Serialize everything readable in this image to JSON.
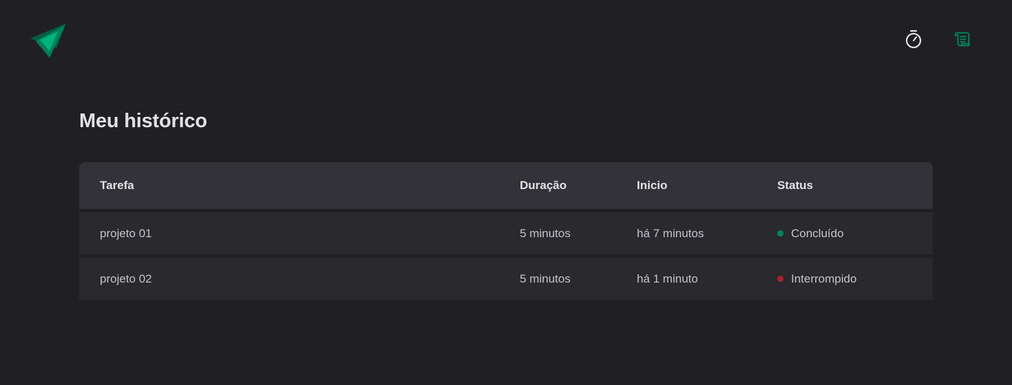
{
  "colors": {
    "background": "#202024",
    "brand": "#00875f",
    "brand_light": "#00b37e",
    "completed": "#00875f",
    "interrupted": "#ab222e",
    "table_header": "#323238",
    "table_row": "#29292e"
  },
  "header": {
    "logo_icon": "triangles-logo-icon",
    "nav": [
      {
        "icon": "timer-icon",
        "active": false
      },
      {
        "icon": "scroll-icon",
        "active": true
      }
    ]
  },
  "main": {
    "title": "Meu histórico",
    "table": {
      "columns": [
        "Tarefa",
        "Duração",
        "Inicio",
        "Status"
      ],
      "rows": [
        {
          "task": "projeto 01",
          "duration": "5 minutos",
          "start": "há 7 minutos",
          "status": "Concluído",
          "status_color": "#00875f"
        },
        {
          "task": "projeto 02",
          "duration": "5 minutos",
          "start": "há 1 minuto",
          "status": "Interrompido",
          "status_color": "#ab222e"
        }
      ]
    }
  }
}
